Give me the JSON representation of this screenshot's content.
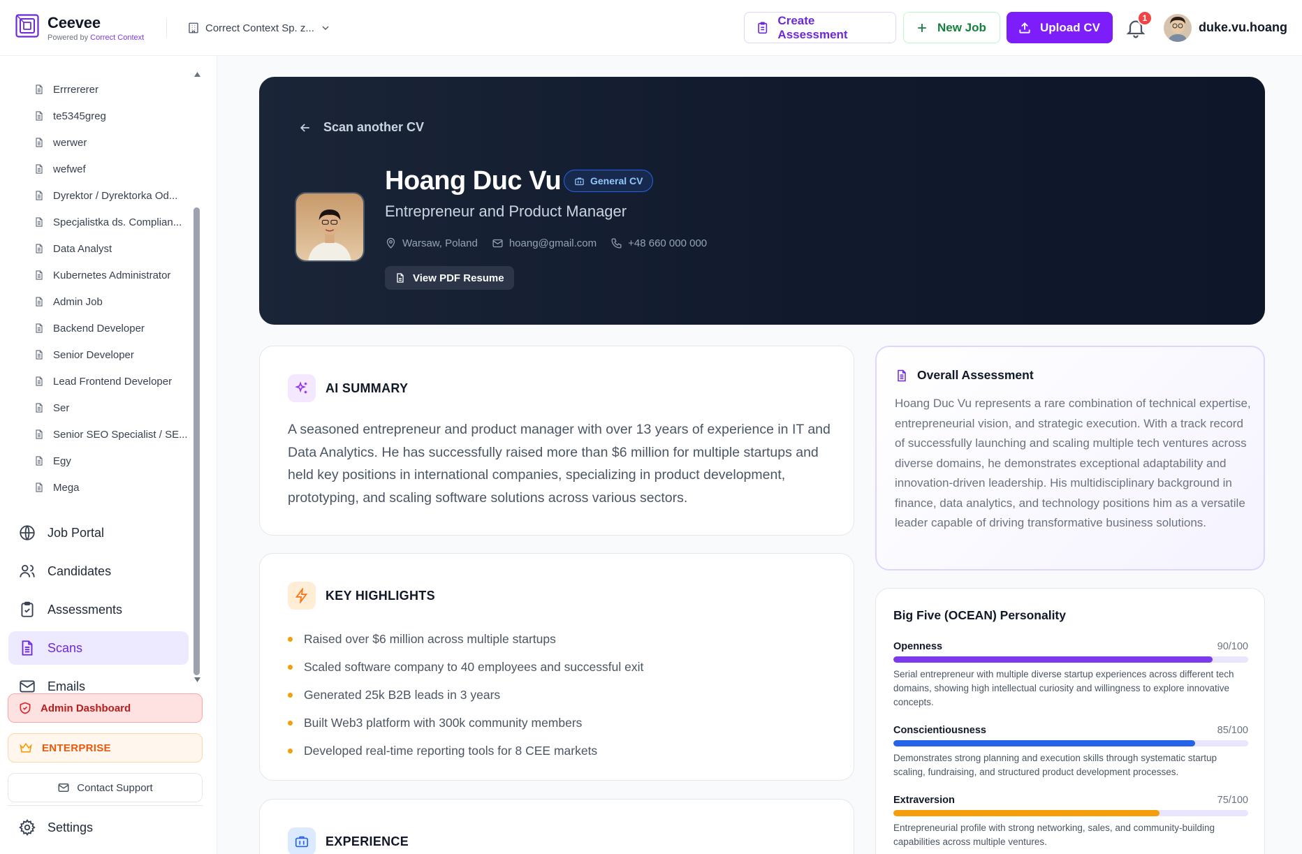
{
  "app": {
    "name": "Ceevee",
    "powered_prefix": "Powered by",
    "powered_brand": "Correct Context",
    "org": "Correct Context Sp. z...",
    "actions": {
      "create_assessment": "Create Assessment",
      "new_job": "New Job",
      "upload_cv": "Upload CV"
    },
    "notifications": "1",
    "username": "duke.vu.hoang"
  },
  "sidebar": {
    "scans": [
      "Errrererer",
      "te5345greg",
      "werwer",
      "wefwef",
      "Dyrektor / Dyrektorka Od...",
      "Specjalistka ds. Complian...",
      "Data Analyst",
      "Kubernetes Administrator",
      "Admin Job",
      "Backend Developer",
      "Senior Developer",
      "Lead Frontend Developer",
      "Ser",
      "Senior SEO Specialist / SE...",
      "Egy",
      "Mega"
    ],
    "nav": {
      "job_portal": "Job Portal",
      "candidates": "Candidates",
      "assessments": "Assessments",
      "scans": "Scans",
      "emails": "Emails",
      "settings": "Settings"
    },
    "admin_dashboard": "Admin Dashboard",
    "enterprise": "ENTERPRISE",
    "contact_support": "Contact Support"
  },
  "profile": {
    "back_label": "Scan another CV",
    "name": "Hoang Duc Vu",
    "badge": "General CV",
    "role": "Entrepreneur and Product Manager",
    "location": "Warsaw, Poland",
    "email": "hoang@gmail.com",
    "phone": "+48 660 000 000",
    "pdf_button": "View PDF Resume"
  },
  "ai_summary": {
    "title": "AI SUMMARY",
    "text": "A seasoned entrepreneur and product manager with over 13 years of experience in IT and Data Analytics. He has successfully raised more than $6 million for multiple startups and held key positions in international companies, specializing in product development, prototyping, and scaling software solutions across various sectors."
  },
  "highlights": {
    "title": "KEY HIGHLIGHTS",
    "items": [
      "Raised over $6 million across multiple startups",
      "Scaled software company to 40 employees and successful exit",
      "Generated 25k B2B leads in 3 years",
      "Built Web3 platform with 300k community members",
      "Developed real-time reporting tools for 8 CEE markets"
    ]
  },
  "experience": {
    "title": "EXPERIENCE"
  },
  "overall": {
    "title": "Overall Assessment",
    "text": "Hoang Duc Vu represents a rare combination of technical expertise, entrepreneurial vision, and strategic execution. With a track record of successfully launching and scaling multiple tech ventures across diverse domains, he demonstrates exceptional adaptability and innovation-driven leadership. His multidisciplinary background in finance, data analytics, and technology positions him as a versatile leader capable of driving transformative business solutions."
  },
  "ocean": {
    "title": "Big Five (OCEAN) Personality",
    "traits": [
      {
        "name": "Openness",
        "score": "90/100",
        "value": 90,
        "color": "#7c3aed",
        "desc": "Serial entrepreneur with multiple diverse startup experiences across different tech domains, showing high intellectual curiosity and willingness to explore innovative concepts."
      },
      {
        "name": "Conscientiousness",
        "score": "85/100",
        "value": 85,
        "color": "#2563eb",
        "desc": "Demonstrates strong planning and execution skills through systematic startup scaling, fundraising, and structured product development processes."
      },
      {
        "name": "Extraversion",
        "score": "75/100",
        "value": 75,
        "color": "#f59e0b",
        "desc": "Entrepreneurial profile with strong networking, sales, and community-building capabilities across multiple ventures."
      }
    ]
  },
  "colors": {
    "accent": "#7c1dfa",
    "hero_bg": "#101a2c",
    "highlight_dot": "#f59e0b"
  }
}
